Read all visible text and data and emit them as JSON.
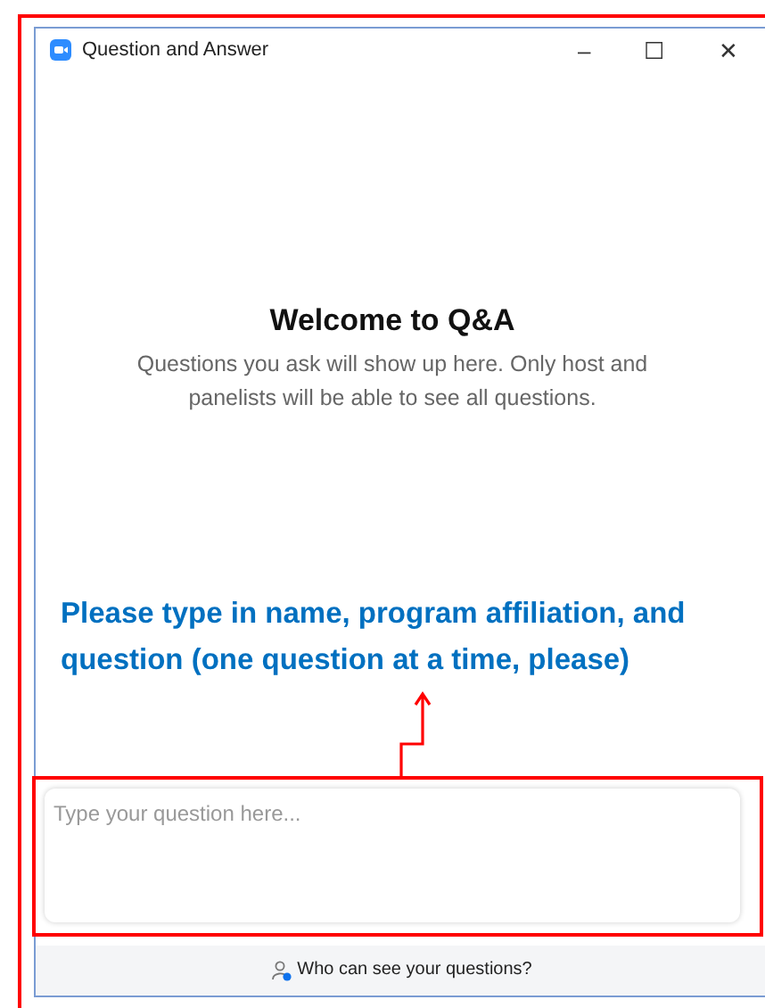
{
  "window": {
    "title": "Question and Answer",
    "controls": [
      "–",
      "☐",
      "✕"
    ]
  },
  "welcome": {
    "heading": "Welcome to Q&A",
    "body": "Questions you ask will show up here. Only host and panelists will be able to see all questions."
  },
  "annotation": {
    "text": "Please type in name, program affiliation, and question (one question at a time, please)"
  },
  "question_field": {
    "placeholder": "Type your question here..."
  },
  "footer": {
    "link": "Who can see your questions?"
  }
}
